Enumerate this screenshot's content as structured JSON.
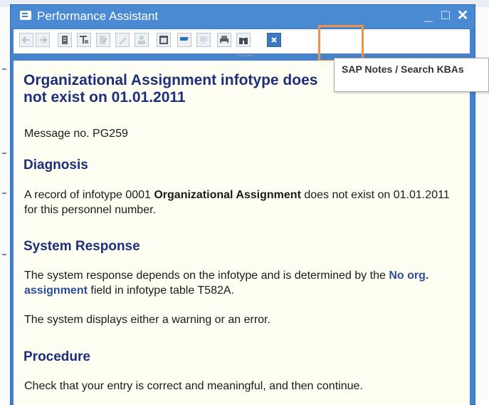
{
  "window": {
    "title": "Performance Assistant",
    "minimize_symbol": "_",
    "maximize_symbol": "□",
    "close_symbol": "✕"
  },
  "toolbar": {
    "buttons": [
      "back-icon",
      "forward-icon",
      "document-icon",
      "technical-info-icon",
      "edit-icon",
      "pencil-icon",
      "user-icon",
      "calendar-icon",
      "flag-icon",
      "monitor-icon",
      "print-icon",
      "binoculars-icon",
      "close-box-icon"
    ],
    "grip": "·····"
  },
  "tooltip": {
    "text": "SAP Notes / Search KBAs"
  },
  "message": {
    "title": "Organizational Assignment infotype does not exist on 01.01.2011",
    "number_label": "Message no. PG259",
    "diagnosis_heading": "Diagnosis",
    "diagnosis_prefix": "A record of infotype 0001 ",
    "diagnosis_bold": "Organizational Assignment",
    "diagnosis_suffix": " does not exist on 01.01.2011 for this personnel number.",
    "response_heading": "System Response",
    "response_prefix": "The system response depends on the infotype and is determined by the ",
    "response_link": "No org. assignment",
    "response_suffix": " field in infotype table T582A.",
    "response_line2": "The system displays either a warning or an error.",
    "procedure_heading": "Procedure",
    "procedure_text": "Check that your entry is correct and meaningful, and then continue."
  }
}
